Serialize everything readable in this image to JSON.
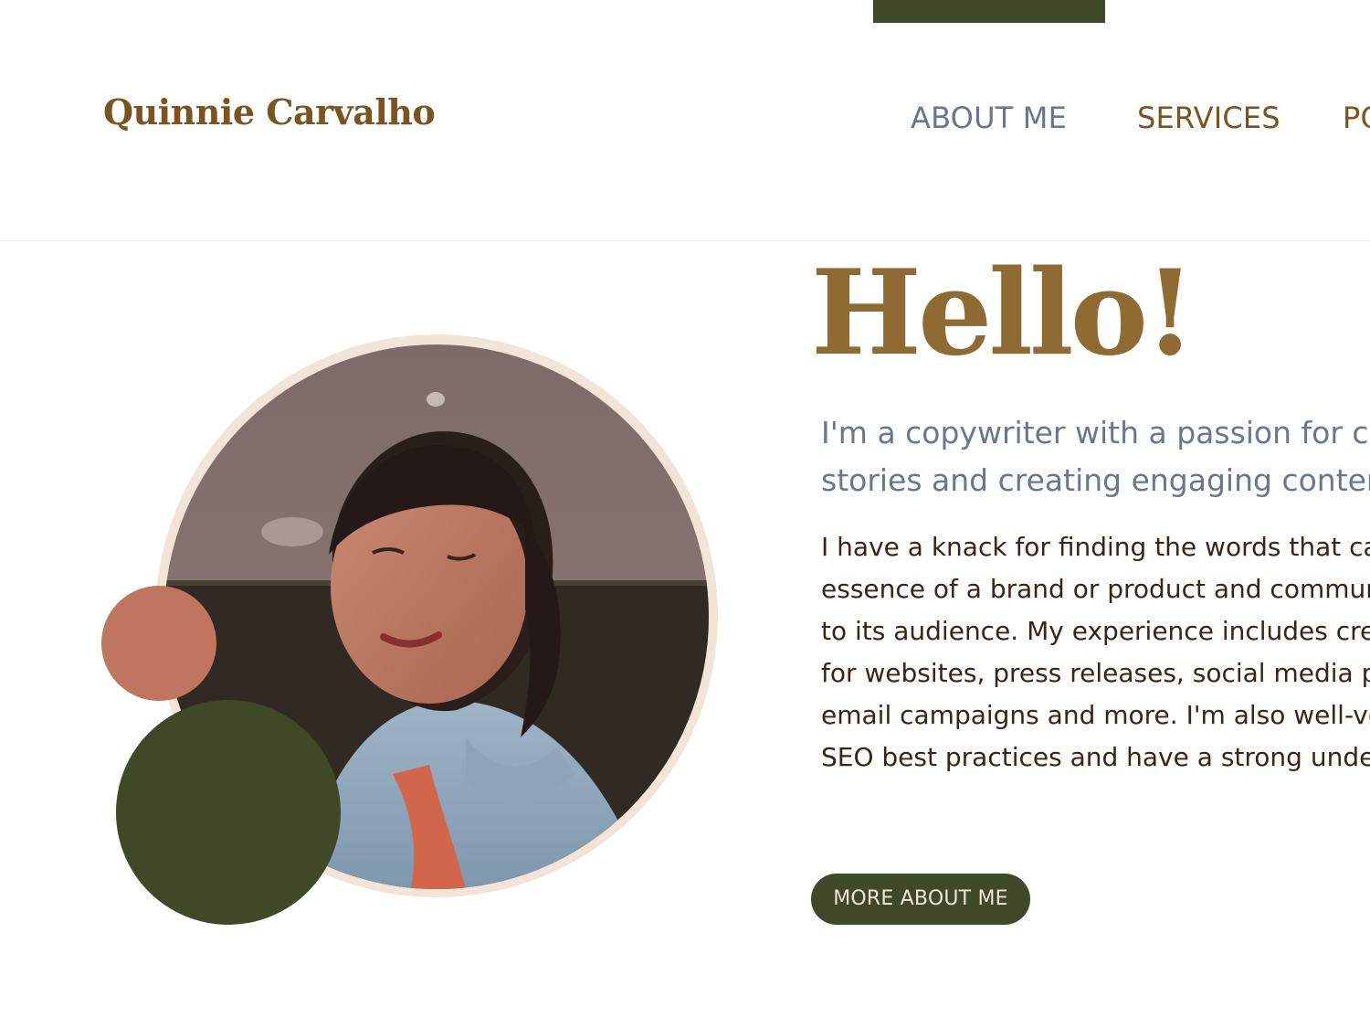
{
  "header": {
    "logo_text": "Quinnie Carvalho",
    "nav": [
      {
        "label": "ABOUT ME"
      },
      {
        "label": "SERVICES"
      },
      {
        "label": "PORTFOLIO"
      }
    ]
  },
  "hero": {
    "title": "Hello!",
    "intro": "I'm a copywriter with a passion for crafting stories and creating engaging content",
    "body": "I have a knack for finding the words that capture the essence of a brand or product and communicating it to its audience. My experience includes creating copy for websites, press releases, social media posts, email campaigns and more. I'm also well-versed in SEO best practices and have a strong understanding of how to optimize content",
    "cta_label": "MORE ABOUT ME",
    "portrait_icon": "portrait-photo"
  },
  "colors": {
    "olive": "#3f4827",
    "terracotta": "#c07560",
    "gold": "#8f6a32",
    "brown": "#7a5420",
    "slate": "#6a7690",
    "cream": "#f2e4d8"
  }
}
